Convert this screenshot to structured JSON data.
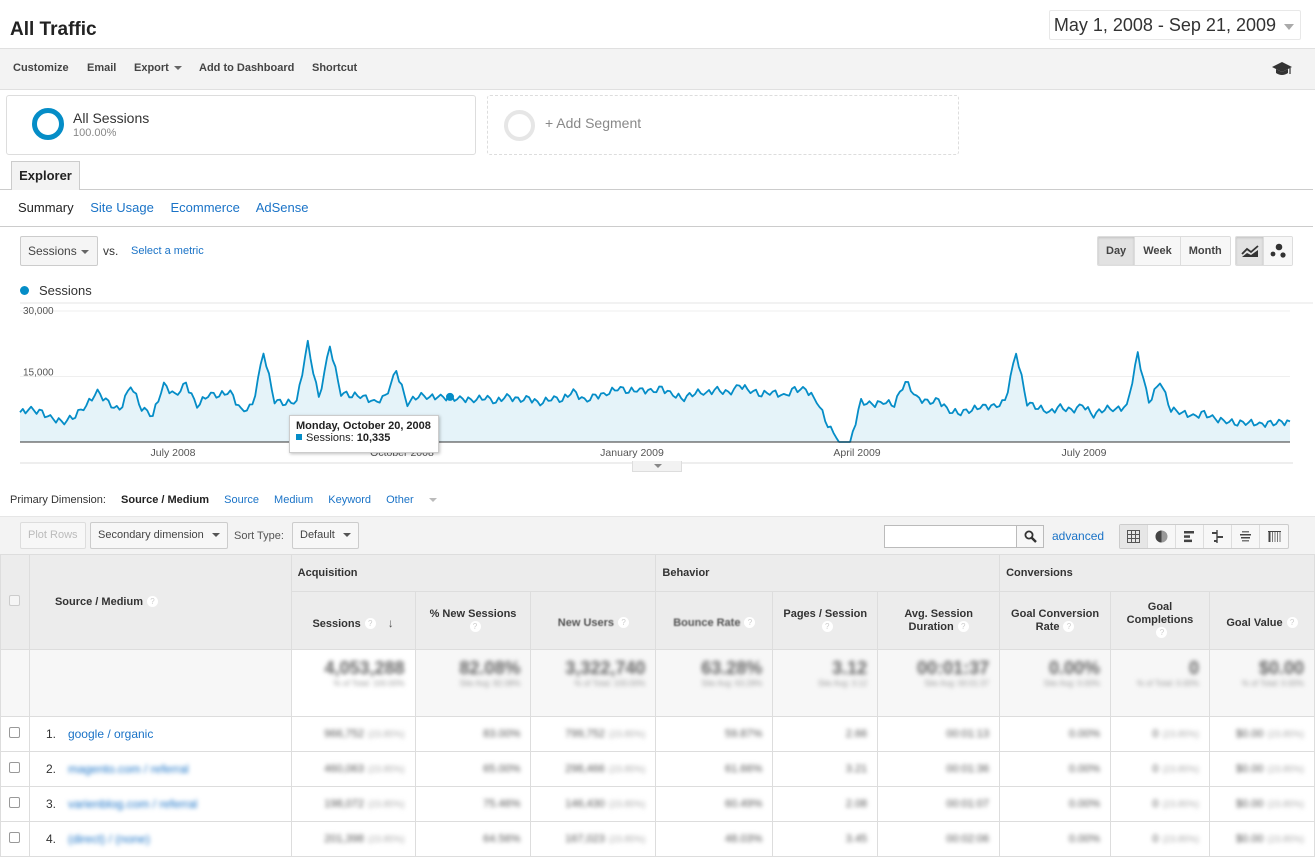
{
  "header": {
    "title": "All Traffic",
    "date_range": "May 1, 2008 - Sep 21, 2009"
  },
  "toolbar": {
    "customize": "Customize",
    "email": "Email",
    "export": "Export",
    "add_to_dashboard": "Add to Dashboard",
    "shortcut": "Shortcut",
    "help_icon": "graduation-cap-icon"
  },
  "segments": {
    "all": {
      "name": "All Sessions",
      "pct": "100.00%"
    },
    "add_label": "+ Add Segment"
  },
  "tabs": {
    "explorer": "Explorer",
    "subtabs": [
      "Summary",
      "Site Usage",
      "Ecommerce",
      "AdSense"
    ]
  },
  "chart_controls": {
    "metric": "Sessions",
    "vs": "vs.",
    "select_metric": "Select a metric",
    "granularity": [
      "Day",
      "Week",
      "Month"
    ],
    "active_granularity": "Day",
    "chart_types": [
      "line-chart-icon",
      "motion-chart-icon"
    ]
  },
  "colors": {
    "accent": "#058dc7",
    "fill": "#e5f3f9",
    "link": "#1a73c7"
  },
  "chart_data": {
    "type": "area",
    "title": "",
    "legend": [
      "Sessions"
    ],
    "legend_position": "top-left",
    "ylabel": "",
    "xlabel": "",
    "y_ticks": [
      "30,000",
      "15,000"
    ],
    "ylim": [
      0,
      30000
    ],
    "x_ticks": [
      "July 2008",
      "October 2008",
      "January 2009",
      "April 2009",
      "July 2009"
    ],
    "x_range": [
      "2008-05-01",
      "2009-09-21"
    ],
    "grid": true,
    "series": [
      {
        "name": "Sessions",
        "weekly_approx": [
          6800,
          7500,
          6600,
          5200,
          4600,
          6200,
          8500,
          11500,
          8800,
          7200,
          13000,
          7800,
          6200,
          13200,
          10500,
          13300,
          8200,
          11000,
          10800,
          11500,
          7000,
          8200,
          20500,
          9500,
          9000,
          9300,
          22500,
          9800,
          22000,
          11200,
          10800,
          10500,
          9000,
          10200,
          16300,
          8800,
          10800,
          10335,
          10300,
          10000,
          9800,
          9600,
          10400,
          9200,
          10500,
          9500,
          10000,
          8800,
          10200,
          9700,
          11700,
          9300,
          10500,
          11000,
          12500,
          11700,
          12000,
          11500,
          12200,
          10800,
          10000,
          11500,
          11200,
          12000,
          11000,
          13000,
          11800,
          11000,
          11500,
          10400,
          12000,
          12000,
          9400,
          4000,
          0,
          0,
          9200,
          8500,
          9200,
          8700,
          14000,
          10200,
          9000,
          9500,
          7000,
          6800,
          7500,
          8200,
          8000,
          9200,
          20500,
          9000,
          8000,
          6800,
          8000,
          7000,
          8500,
          6200,
          7800,
          7500,
          8000,
          20000,
          9000,
          14000,
          7500,
          6800,
          5800,
          6500,
          5200,
          4800,
          4400,
          4600,
          4000,
          4200,
          4500
        ]
      }
    ],
    "tooltip": {
      "date": "Monday, October 20, 2008",
      "label": "Sessions:",
      "value": "10,335"
    }
  },
  "dimension_bar": {
    "label": "Primary Dimension:",
    "current": "Source / Medium",
    "options": [
      "Source",
      "Medium",
      "Keyword",
      "Other"
    ]
  },
  "table_tools": {
    "plot_rows": "Plot Rows",
    "secondary_dimension": "Secondary dimension",
    "sort_type_label": "Sort Type:",
    "sort_type": "Default",
    "search_placeholder": "",
    "advanced": "advanced",
    "views": [
      "table-view-icon",
      "pie-view-icon",
      "bar-view-icon",
      "comparison-view-icon",
      "term-cloud-icon",
      "pivot-view-icon"
    ]
  },
  "table": {
    "dimension_header": "Source / Medium",
    "groups": [
      "Acquisition",
      "Behavior",
      "Conversions"
    ],
    "columns": [
      "Sessions",
      "% New Sessions",
      "New Users",
      "Bounce Rate",
      "Pages / Session",
      "Avg. Session Duration",
      "Goal Conversion Rate",
      "Goal Completions",
      "Goal Value"
    ],
    "totals": [
      "4,053,288",
      "82.08%",
      "3,322,740",
      "63.28%",
      "3.12",
      "00:01:37",
      "0.00%",
      "0",
      "$0.00"
    ],
    "rows": [
      {
        "num": "1.",
        "source": "google / organic",
        "cells": [
          "966,752",
          "83.00%",
          "799,752",
          "59.87%",
          "2.66",
          "00:01:13",
          "0.00%",
          "0",
          "$0.00"
        ]
      },
      {
        "num": "2.",
        "source": "magento.com / referral",
        "cells": [
          "460,063",
          "65.00%",
          "298,466",
          "61.66%",
          "3.21",
          "00:01:36",
          "0.00%",
          "0",
          "$0.00"
        ]
      },
      {
        "num": "3.",
        "source": "varienblog.com / referral",
        "cells": [
          "198,072",
          "75.46%",
          "146,430",
          "60.49%",
          "2.08",
          "00:01:07",
          "0.00%",
          "0",
          "$0.00"
        ]
      },
      {
        "num": "4.",
        "source": "(direct) / (none)",
        "cells": [
          "201,398",
          "64.56%",
          "167,023",
          "48.03%",
          "3.45",
          "00:02:06",
          "0.00%",
          "0",
          "$0.00"
        ]
      }
    ]
  }
}
